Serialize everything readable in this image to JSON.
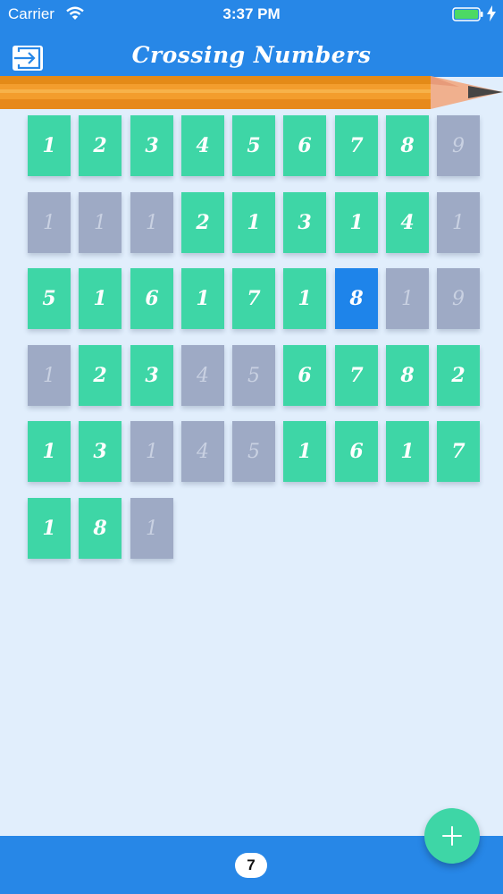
{
  "status": {
    "carrier": "Carrier",
    "time": "3:37 PM"
  },
  "header": {
    "title": "Crossing Numbers",
    "exit_icon": "exit-arrow-icon"
  },
  "board": {
    "colors": {
      "active": "#3ed6a6",
      "crossed": "#9eaac5",
      "selected": "#1e84ea"
    },
    "rows": [
      [
        {
          "v": "1",
          "s": "active"
        },
        {
          "v": "2",
          "s": "active"
        },
        {
          "v": "3",
          "s": "active"
        },
        {
          "v": "4",
          "s": "active"
        },
        {
          "v": "5",
          "s": "active"
        },
        {
          "v": "6",
          "s": "active"
        },
        {
          "v": "7",
          "s": "active"
        },
        {
          "v": "8",
          "s": "active"
        },
        {
          "v": "9",
          "s": "crossed"
        }
      ],
      [
        {
          "v": "1",
          "s": "crossed"
        },
        {
          "v": "1",
          "s": "crossed"
        },
        {
          "v": "1",
          "s": "crossed"
        },
        {
          "v": "2",
          "s": "active"
        },
        {
          "v": "1",
          "s": "active"
        },
        {
          "v": "3",
          "s": "active"
        },
        {
          "v": "1",
          "s": "active"
        },
        {
          "v": "4",
          "s": "active"
        },
        {
          "v": "1",
          "s": "crossed"
        }
      ],
      [
        {
          "v": "5",
          "s": "active"
        },
        {
          "v": "1",
          "s": "active"
        },
        {
          "v": "6",
          "s": "active"
        },
        {
          "v": "1",
          "s": "active"
        },
        {
          "v": "7",
          "s": "active"
        },
        {
          "v": "1",
          "s": "active"
        },
        {
          "v": "8",
          "s": "selected"
        },
        {
          "v": "1",
          "s": "crossed"
        },
        {
          "v": "9",
          "s": "crossed"
        }
      ],
      [
        {
          "v": "1",
          "s": "crossed"
        },
        {
          "v": "2",
          "s": "active"
        },
        {
          "v": "3",
          "s": "active"
        },
        {
          "v": "4",
          "s": "crossed"
        },
        {
          "v": "5",
          "s": "crossed"
        },
        {
          "v": "6",
          "s": "active"
        },
        {
          "v": "7",
          "s": "active"
        },
        {
          "v": "8",
          "s": "active"
        },
        {
          "v": "2",
          "s": "active"
        }
      ],
      [
        {
          "v": "1",
          "s": "active"
        },
        {
          "v": "3",
          "s": "active"
        },
        {
          "v": "1",
          "s": "crossed"
        },
        {
          "v": "4",
          "s": "crossed"
        },
        {
          "v": "5",
          "s": "crossed"
        },
        {
          "v": "1",
          "s": "active"
        },
        {
          "v": "6",
          "s": "active"
        },
        {
          "v": "1",
          "s": "active"
        },
        {
          "v": "7",
          "s": "active"
        }
      ],
      [
        {
          "v": "1",
          "s": "active"
        },
        {
          "v": "8",
          "s": "active"
        },
        {
          "v": "1",
          "s": "crossed"
        }
      ]
    ]
  },
  "footer": {
    "remaining": "7",
    "add_icon": "plus-icon"
  }
}
